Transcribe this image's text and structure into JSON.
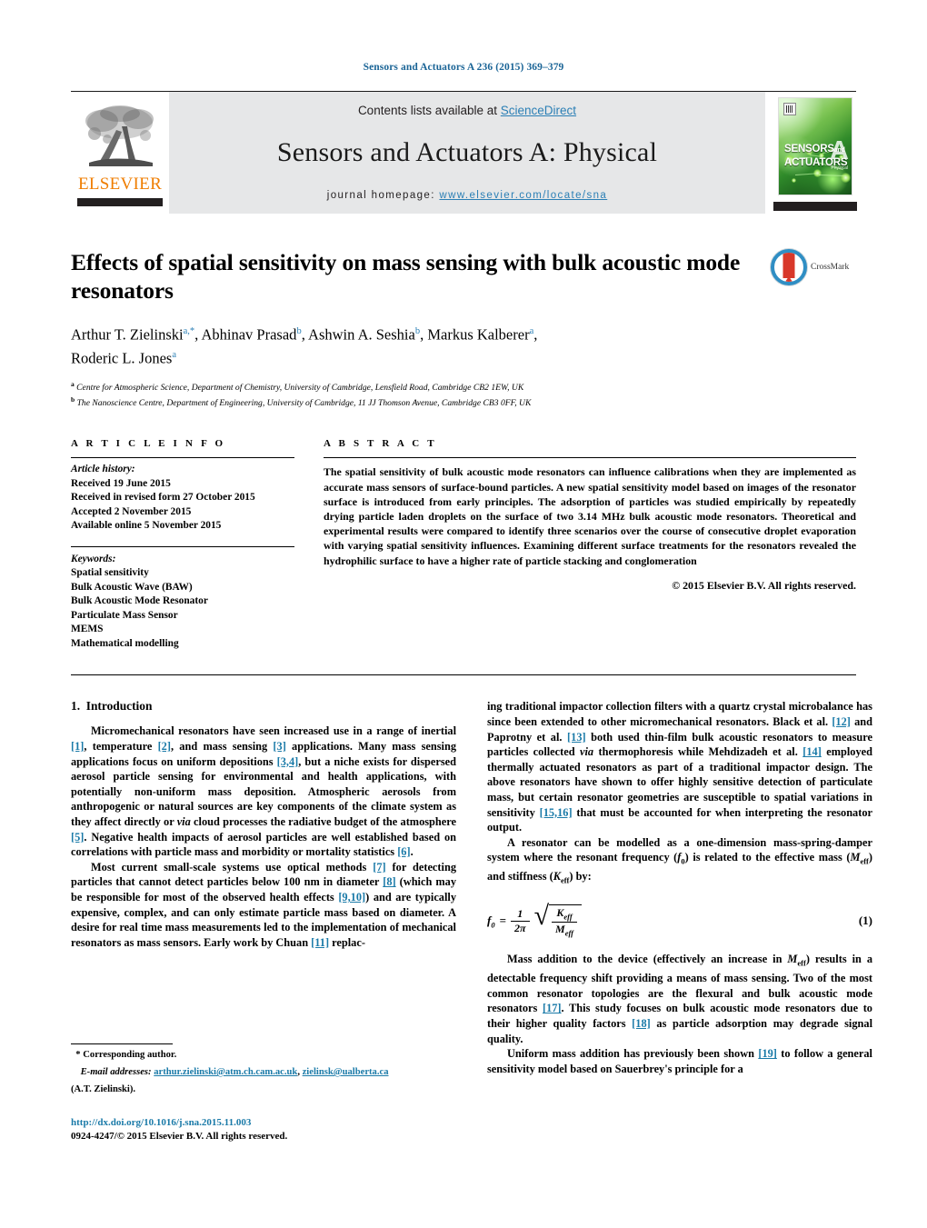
{
  "running_head": "Sensors and Actuators A 236 (2015) 369–379",
  "masthead": {
    "contents_prefix": "Contents lists available at ",
    "sciencedirect": "ScienceDirect",
    "journal_title": "Sensors and Actuators A: Physical",
    "homepage_label": "journal homepage: ",
    "homepage_url": "www.elsevier.com/locate/sna",
    "publisher": "ELSEVIER",
    "cover_title_line1": "SENSORS",
    "cover_title_and": "and",
    "cover_title_line2": "ACTUATORS",
    "cover_letter": "A",
    "cover_sub": "Physical",
    "accent_blue": "#2b7fb5",
    "accent_orange": "#ef7d00"
  },
  "article": {
    "title": "Effects of spatial sensitivity on mass sensing with bulk acoustic mode resonators",
    "crossmark_label": "CrossMark",
    "authors": [
      {
        "name": "Arthur T. Zielinski",
        "marks": "a,*",
        "sep": ", "
      },
      {
        "name": "Abhinav Prasad",
        "marks": "b",
        "sep": ", "
      },
      {
        "name": "Ashwin A. Seshia",
        "marks": "b",
        "sep": ", "
      },
      {
        "name": "Markus Kalberer",
        "marks": "a",
        "sep": ","
      },
      {
        "name": "Roderic L. Jones",
        "marks": "a",
        "sep": ""
      }
    ],
    "affiliations": [
      {
        "mark": "a",
        "text": "Centre for Atmospheric Science, Department of Chemistry, University of Cambridge, Lensfield Road, Cambridge CB2 1EW, UK"
      },
      {
        "mark": "b",
        "text": "The Nanoscience Centre, Department of Engineering, University of Cambridge, 11 JJ Thomson Avenue, Cambridge CB3 0FF, UK"
      }
    ]
  },
  "article_info": {
    "heading": "A R T I C L E    I N F O",
    "history_label": "Article history:",
    "history": [
      "Received 19 June 2015",
      "Received in revised form 27 October 2015",
      "Accepted 2 November 2015",
      "Available online 5 November 2015"
    ],
    "keywords_label": "Keywords:",
    "keywords": [
      "Spatial sensitivity",
      "Bulk Acoustic Wave (BAW)",
      "Bulk Acoustic Mode Resonator",
      "Particulate Mass Sensor",
      "MEMS",
      "Mathematical modelling"
    ]
  },
  "abstract": {
    "heading": "A B S T R A C T",
    "text": "The spatial sensitivity of bulk acoustic mode resonators can influence calibrations when they are implemented as accurate mass sensors of surface-bound particles. A new spatial sensitivity model based on images of the resonator surface is introduced from early principles. The adsorption of particles was studied empirically by repeatedly drying particle laden droplets on the surface of two 3.14 MHz bulk acoustic mode resonators. Theoretical and experimental results were compared to identify three scenarios over the course of consecutive droplet evaporation with varying spatial sensitivity influences. Examining different surface treatments for the resonators revealed the hydrophilic surface to have a higher rate of particle stacking and conglomeration",
    "copyright": "© 2015 Elsevier B.V. All rights reserved."
  },
  "body": {
    "section_number": "1.",
    "section_title": "Introduction",
    "left_para_1_a": "Micromechanical resonators have seen increased use in a range of inertial ",
    "left_para_1_r1": "[1]",
    "left_para_1_b": ", temperature ",
    "left_para_1_r2": "[2]",
    "left_para_1_c": ", and mass sensing ",
    "left_para_1_r3": "[3]",
    "left_para_1_d": " applications. Many mass sensing applications focus on uniform depositions ",
    "left_para_1_r4": "[3,4]",
    "left_para_1_e": ", but a niche exists for dispersed aerosol particle sensing for environmental and health applications, with potentially non-uniform mass deposition. Atmospheric aerosols from anthropogenic or natural sources are key components of the climate system as they affect directly or ",
    "left_para_1_italic": "via",
    "left_para_1_f": " cloud processes the radiative budget of the atmosphere ",
    "left_para_1_r5": "[5]",
    "left_para_1_g": ". Negative health impacts of aerosol particles are well established based on correlations with particle mass and morbidity or mortality statistics ",
    "left_para_1_r6": "[6]",
    "left_para_1_h": ".",
    "left_para_2_a": "Most current small-scale systems use optical methods ",
    "left_para_2_r1": "[7]",
    "left_para_2_b": " for detecting particles that cannot detect particles below 100 nm in diameter ",
    "left_para_2_r2": "[8]",
    "left_para_2_c": " (which may be responsible for most of the observed health effects ",
    "left_para_2_r3": "[9,10]",
    "left_para_2_d": ") and are typically expensive, complex, and can only estimate particle mass based on diameter. A desire for real time mass measurements led to the implementation of mechanical resonators as mass sensors. Early work by Chuan ",
    "left_para_2_r4": "[11]",
    "left_para_2_e": " replac-",
    "right_para_1_a": "ing traditional impactor collection filters with a quartz crystal microbalance has since been extended to other micromechanical resonators. Black et al. ",
    "right_para_1_r1": "[12]",
    "right_para_1_b": " and Paprotny et al. ",
    "right_para_1_r2": "[13]",
    "right_para_1_c": " both used thin-film bulk acoustic resonators to measure particles collected ",
    "right_para_1_italic": "via",
    "right_para_1_d": " thermophoresis while Mehdizadeh et al. ",
    "right_para_1_r3": "[14]",
    "right_para_1_e": " employed thermally actuated resonators as part of a traditional impactor design. The above resonators have shown to offer highly sensitive detection of particulate mass, but certain resonator geometries are susceptible to spatial variations in sensitivity ",
    "right_para_1_r4": "[15,16]",
    "right_para_1_f": " that must be accounted for when interpreting the resonator output.",
    "right_para_2_a": "A resonator can be modelled as a one-dimension mass-spring-damper system where the resonant frequency (",
    "right_para_2_f0": "f",
    "right_para_2_f0sub": "0",
    "right_para_2_b": ") is related to the effective mass (",
    "right_para_2_M": "M",
    "right_para_2_Msub": "eff",
    "right_para_2_c": ") and stiffness (",
    "right_para_2_K": "K",
    "right_para_2_Ksub": "eff",
    "right_para_2_d": ") by:",
    "equation": {
      "lhs_sym": "f",
      "lhs_sub": "0",
      "eq": "=",
      "frac_num": "1",
      "frac_den": "2π",
      "sqrt_num": "K",
      "sqrt_num_sub": "eff",
      "sqrt_den": "M",
      "sqrt_den_sub": "eff",
      "number": "(1)"
    },
    "right_para_3_a": "Mass addition to the device (effectively an increase in ",
    "right_para_3_M": "M",
    "right_para_3_Msub": "eff",
    "right_para_3_b": ") results in a detectable frequency shift providing a means of mass sensing. Two of the most common resonator topologies are the flexural and bulk acoustic mode resonators ",
    "right_para_3_r1": "[17]",
    "right_para_3_c": ". This study focuses on bulk acoustic mode resonators due to their higher quality factors ",
    "right_para_3_r2": "[18]",
    "right_para_3_d": " as particle adsorption may degrade signal quality.",
    "right_para_4_a": "Uniform mass addition has previously been shown ",
    "right_para_4_r1": "[19]",
    "right_para_4_b": " to follow a general sensitivity model based on Sauerbrey's principle for a"
  },
  "footnote": {
    "star": "*",
    "corresponding": " Corresponding author.",
    "email_label": "E-mail addresses:",
    "email_1": "arthur.zielinski@atm.ch.cam.ac.uk",
    "email_sep": ", ",
    "email_2": "zielinsk@ualberta.ca",
    "email_author": "(A.T. Zielinski).",
    "doi": "http://dx.doi.org/10.1016/j.sna.2015.11.003",
    "issn": "0924-4247/© 2015 Elsevier B.V. All rights reserved."
  }
}
